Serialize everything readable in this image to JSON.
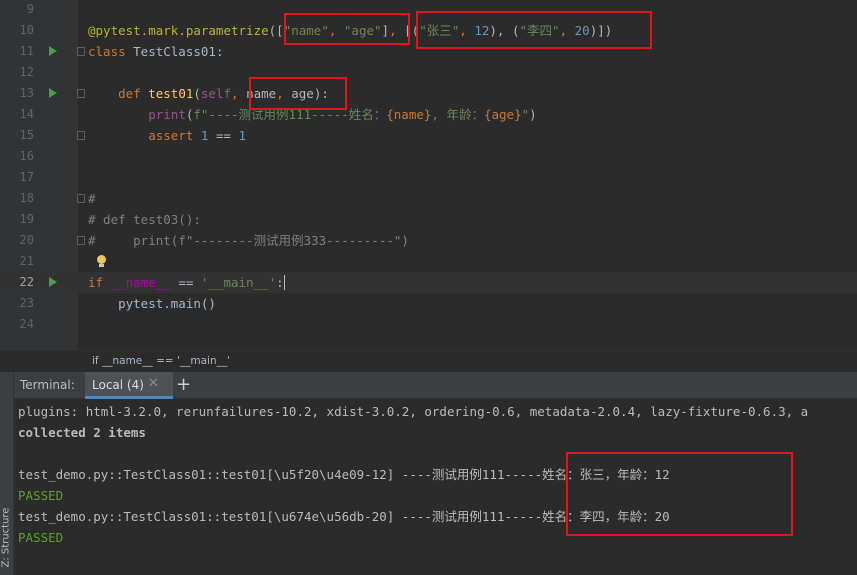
{
  "editor": {
    "lines": [
      {
        "num": "9"
      },
      {
        "num": "10",
        "parts": [
          {
            "t": "@pytest.mark.parametrize",
            "c": "deco"
          },
          {
            "t": "(",
            "c": "plain"
          },
          {
            "t": "[",
            "c": "plain"
          },
          {
            "t": "\"name\"",
            "c": "str"
          },
          {
            "t": ", ",
            "c": "kw"
          },
          {
            "t": "\"age\"",
            "c": "str"
          },
          {
            "t": "]",
            "c": "plain"
          },
          {
            "t": ", ",
            "c": "kw"
          },
          {
            "t": "[(",
            "c": "plain"
          },
          {
            "t": "\"张三\"",
            "c": "str"
          },
          {
            "t": ", ",
            "c": "kw"
          },
          {
            "t": "12",
            "c": "num"
          },
          {
            "t": "), (",
            "c": "plain"
          },
          {
            "t": "\"李四\"",
            "c": "str"
          },
          {
            "t": ", ",
            "c": "kw"
          },
          {
            "t": "20",
            "c": "num"
          },
          {
            "t": ")])",
            "c": "plain"
          }
        ]
      },
      {
        "num": "11",
        "run": true,
        "fold": true,
        "parts": [
          {
            "t": "class ",
            "c": "kw"
          },
          {
            "t": "TestClass01:",
            "c": "plain"
          }
        ]
      },
      {
        "num": "12"
      },
      {
        "num": "13",
        "run": true,
        "fold": true,
        "parts": [
          {
            "t": "    ",
            "c": "plain"
          },
          {
            "t": "def ",
            "c": "kw"
          },
          {
            "t": "test01",
            "c": "fn"
          },
          {
            "t": "(",
            "c": "plain"
          },
          {
            "t": "self",
            "c": "self"
          },
          {
            "t": ", ",
            "c": "kw"
          },
          {
            "t": "name",
            "c": "plain"
          },
          {
            "t": ", ",
            "c": "kw"
          },
          {
            "t": "age):",
            "c": "plain"
          }
        ]
      },
      {
        "num": "14",
        "parts": [
          {
            "t": "        ",
            "c": "plain"
          },
          {
            "t": "print",
            "c": "self"
          },
          {
            "t": "(",
            "c": "plain"
          },
          {
            "t": "f\"----测试用例111-----姓名：",
            "c": "str"
          },
          {
            "t": "{name}",
            "c": "kw"
          },
          {
            "t": ", 年龄：",
            "c": "str"
          },
          {
            "t": "{age}",
            "c": "kw"
          },
          {
            "t": "\"",
            "c": "str"
          },
          {
            "t": ")",
            "c": "plain"
          }
        ]
      },
      {
        "num": "15",
        "fold": true,
        "parts": [
          {
            "t": "        ",
            "c": "plain"
          },
          {
            "t": "assert ",
            "c": "kw"
          },
          {
            "t": "1",
            "c": "num"
          },
          {
            "t": " == ",
            "c": "plain"
          },
          {
            "t": "1",
            "c": "num"
          }
        ]
      },
      {
        "num": "16"
      },
      {
        "num": "17"
      },
      {
        "num": "18",
        "fold": true,
        "parts": [
          {
            "t": "#",
            "c": "cmt"
          }
        ]
      },
      {
        "num": "19",
        "parts": [
          {
            "t": "# def test03():",
            "c": "cmt"
          }
        ]
      },
      {
        "num": "20",
        "fold": true,
        "parts": [
          {
            "t": "#     print(f\"--------测试用例333---------\")",
            "c": "cmt"
          }
        ]
      },
      {
        "num": "21",
        "bulb": true
      },
      {
        "num": "22",
        "run": true,
        "current": true,
        "parts": [
          {
            "t": "if ",
            "c": "kw"
          },
          {
            "t": "__name__",
            "c": "dunder"
          },
          {
            "t": " == ",
            "c": "plain"
          },
          {
            "t": "'__main__'",
            "c": "str"
          },
          {
            "t": ":",
            "c": "plain"
          }
        ]
      },
      {
        "num": "23",
        "parts": [
          {
            "t": "    pytest.main()",
            "c": "plain"
          }
        ]
      },
      {
        "num": "24"
      }
    ]
  },
  "breadcrumb": "if __name__ == '__main__'",
  "terminal_header": {
    "title": "Terminal:",
    "tab_label": "Local (4)",
    "close_symbol": "✕",
    "add_symbol": "+"
  },
  "side_strip": {
    "structure_label": "Z: Structure"
  },
  "terminal": {
    "lines": [
      {
        "text": "plugins: html-3.2.0, rerunfailures-10.2, xdist-3.0.2, ordering-0.6, metadata-2.0.4, lazy-fixture-0.6.3, a"
      },
      {
        "text": "collected 2 items",
        "bold": true
      },
      {
        "text": ""
      },
      {
        "text": "test_demo.py::TestClass01::test01[\\u5f20\\u4e09-12] ----测试用例111-----姓名：张三，年龄：12"
      },
      {
        "text": "PASSED",
        "status": "passed"
      },
      {
        "text": "test_demo.py::TestClass01::test01[\\u674e\\u56db-20] ----测试用例111-----姓名：李四，年龄：20"
      },
      {
        "text": "PASSED",
        "status": "passed"
      }
    ]
  },
  "colors": {
    "keyword": "#cc7832",
    "string": "#6a8759",
    "number": "#6897bb",
    "decorator": "#bbb529",
    "function": "#ffc66d",
    "self": "#94558d",
    "comment": "#808080",
    "passed": "#5f9f2c",
    "highlight_box": "#e0161d"
  }
}
